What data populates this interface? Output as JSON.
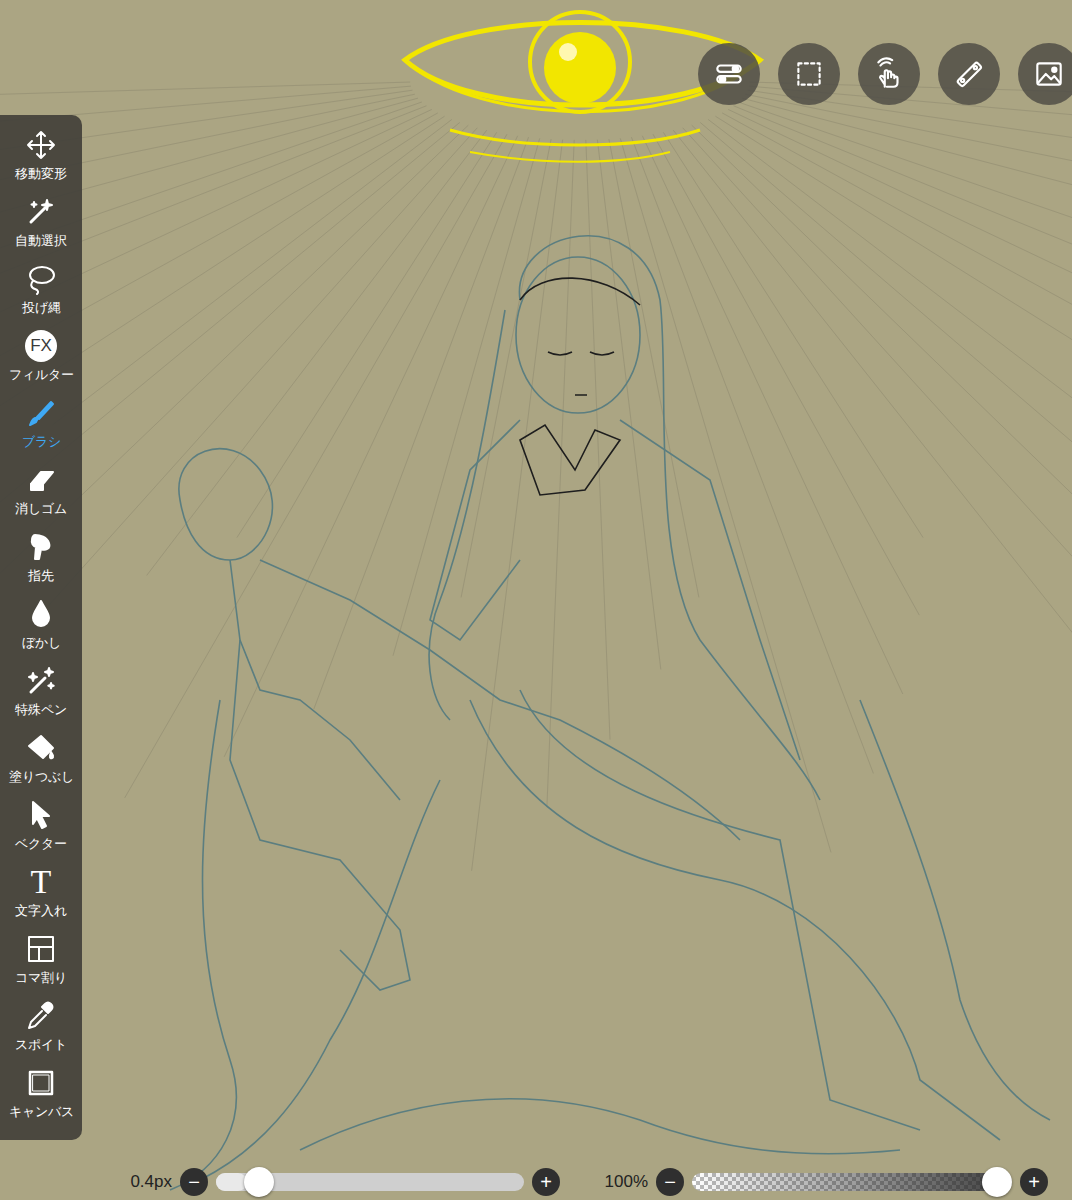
{
  "toolbar": {
    "items": [
      {
        "label": "移動変形",
        "selected": false
      },
      {
        "label": "自動選択",
        "selected": false
      },
      {
        "label": "投げ縄",
        "selected": false
      },
      {
        "label": "フィルター",
        "selected": false,
        "glyph": "FX"
      },
      {
        "label": "ブラシ",
        "selected": true
      },
      {
        "label": "消しゴム",
        "selected": false
      },
      {
        "label": "指先",
        "selected": false
      },
      {
        "label": "ぼかし",
        "selected": false
      },
      {
        "label": "特殊ペン",
        "selected": false
      },
      {
        "label": "塗りつぶし",
        "selected": false
      },
      {
        "label": "ベクター",
        "selected": false
      },
      {
        "label": "文字入れ",
        "selected": false,
        "glyph": "T"
      },
      {
        "label": "コマ割り",
        "selected": false
      },
      {
        "label": "スポイト",
        "selected": false
      },
      {
        "label": "キャンバス",
        "selected": false
      }
    ]
  },
  "bottom_bar": {
    "brush_size": {
      "reading": "0.4px",
      "level": 0.1,
      "minus": "−",
      "plus": "+"
    },
    "opacity": {
      "reading": "100%",
      "level": 1,
      "minus": "−",
      "plus": "+"
    }
  }
}
